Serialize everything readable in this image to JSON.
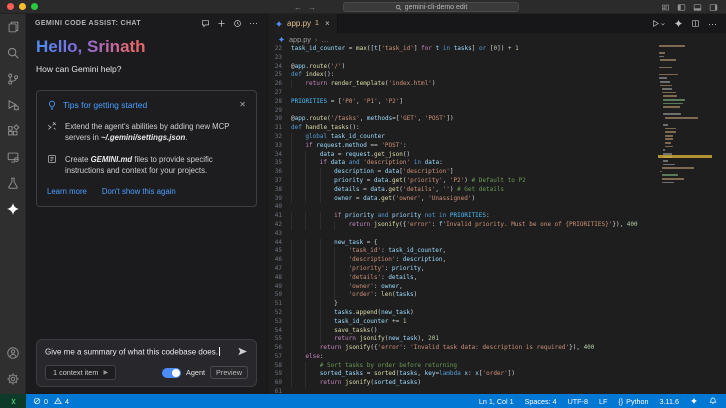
{
  "title_bar": {
    "search_label": "gemini-cli-demo edit"
  },
  "activity_bar": {
    "items": [
      "explorer",
      "search",
      "source-control",
      "run-and-debug",
      "extensions",
      "remote-explorer",
      "testing",
      "gemini-assist",
      "accounts",
      "settings"
    ]
  },
  "chat_panel": {
    "title": "GEMINI CODE ASSIST: CHAT",
    "greeting": "Hello, Srinath",
    "subtitle": "How can Gemini help?",
    "tips": {
      "title": "Tips for getting started",
      "item1_before": "Extend the agent's abilities by adding new MCP servers in ",
      "item1_path": "~/.gemini/settings.json",
      "item1_after": ".",
      "item2_before": "Create ",
      "item2_path": "GEMINI.md",
      "item2_after": " files to provide specific instructions and context for your projects.",
      "learn_more": "Learn more",
      "dismiss": "Don't show this again"
    },
    "input": {
      "value": "Give me a summary of what this codebase does.",
      "context_button": "1 context item",
      "agent_toggle": "Agent",
      "preview_badge": "Preview"
    }
  },
  "editor": {
    "tab_label": "app.py",
    "tab_badge": "1",
    "breadcrumb_file": "app.py",
    "breadcrumb_tail": "…",
    "first_line_number": 22,
    "code_lines": [
      "task_id_counter = max([t['task_id'] for t in tasks] or [0]) + 1",
      "",
      "@app.route('/')",
      "def index():",
      "    return render_template('index.html')",
      "",
      "PRIORITIES = ['P0', 'P1', 'P2']",
      "",
      "@app.route('/tasks', methods=['GET', 'POST'])",
      "def handle_tasks():",
      "    global task_id_counter",
      "    if request.method == 'POST':",
      "        data = request.get_json()",
      "        if data and 'description' in data:",
      "            description = data['description']",
      "            priority = data.get('priority', 'P2') # Default to P2",
      "            details = data.get('details', '') # Get details",
      "            owner = data.get('owner', 'Unassigned')",
      "",
      "            if priority and priority not in PRIORITIES:",
      "                return jsonify({'error': f'Invalid priority. Must be one of {PRIORITIES}'}), 400",
      "",
      "            new_task = {",
      "                'task_id': task_id_counter,",
      "                'description': description,",
      "                'priority': priority,",
      "                'details': details,",
      "                'owner': owner,",
      "                'order': len(tasks)",
      "            }",
      "            tasks.append(new_task)",
      "            task_id_counter += 1",
      "            save_tasks()",
      "            return jsonify(new_task), 201",
      "        return jsonify({'error': 'Invalid task data: description is required'}), 400",
      "    else:",
      "        # Sort tasks by order before returning",
      "        sorted_tasks = sorted(tasks, key=lambda x: x['order'])",
      "        return jsonify(sorted_tasks)",
      ""
    ]
  },
  "status_bar": {
    "errors": "0",
    "warnings": "4",
    "cursor": "Ln 1, Col 1",
    "indent": "Spaces: 4",
    "encoding": "UTF-8",
    "eol": "LF",
    "language_icon": "{}",
    "language": "Python",
    "interpreter": "3.11.6"
  }
}
